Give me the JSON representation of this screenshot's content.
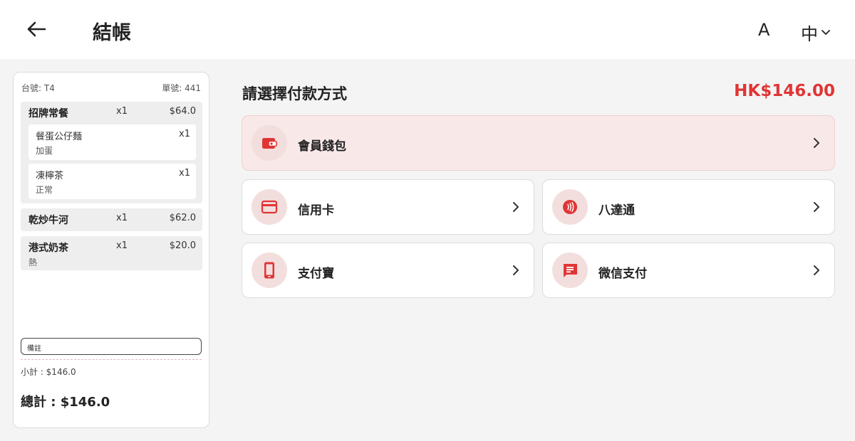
{
  "header": {
    "title": "結帳",
    "font_button": "A",
    "lang_button": "中"
  },
  "order": {
    "table_label": "台號: T4",
    "order_no_label": "單號: 441",
    "items": [
      {
        "name": "招牌常餐",
        "qty": "x1",
        "price": "$64.0",
        "sub_items": [
          {
            "name": "餐蛋公仔麵",
            "qty": "x1",
            "note": "加蛋"
          },
          {
            "name": "凍檸茶",
            "qty": "x1",
            "note": "正常"
          }
        ]
      },
      {
        "name": "乾炒牛河",
        "qty": "x1",
        "price": "$62.0"
      },
      {
        "name": "港式奶茶",
        "qty": "x1",
        "price": "$20.0",
        "note": "熱"
      }
    ],
    "remark_placeholder": "備註",
    "subtotal": "小計 : $146.0",
    "total": "總計 : $146.0"
  },
  "payment": {
    "title": "請選擇付款方式",
    "amount": "HK$146.00",
    "methods": [
      {
        "label": "會員錢包",
        "icon": "wallet-icon"
      },
      {
        "label": "信用卡",
        "icon": "credit-card-icon"
      },
      {
        "label": "八達通",
        "icon": "contactless-icon"
      },
      {
        "label": "支付寶",
        "icon": "phone-icon"
      },
      {
        "label": "微信支付",
        "icon": "chat-icon"
      }
    ]
  },
  "colors": {
    "accent": "#e03535",
    "icon_bg": "#f3dede",
    "highlight_bg": "#f9e8e8"
  }
}
